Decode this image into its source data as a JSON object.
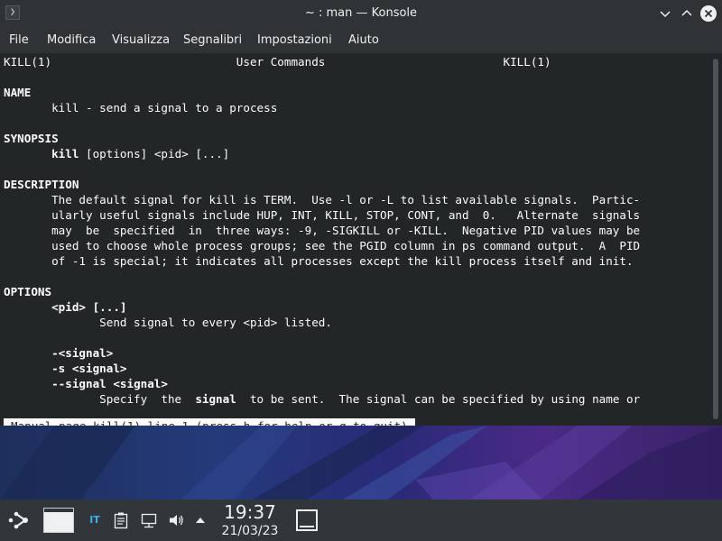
{
  "window": {
    "title": "~ : man — Konsole",
    "app_icon_glyph": "❯"
  },
  "menubar": {
    "items": [
      "File",
      "Modifica",
      "Visualizza",
      "Segnalibri",
      "Impostazioni",
      "Aiuto"
    ]
  },
  "terminal": {
    "header": "KILL(1)                           User Commands                          KILL(1)",
    "name_heading": "NAME",
    "name_line": "       kill - send a signal to a process",
    "synopsis_heading": "SYNOPSIS",
    "synopsis_cmd": "kill",
    "synopsis_rest": " [options] <pid> [...]",
    "description_heading": "DESCRIPTION",
    "description_lines": [
      "       The default signal for kill is TERM.  Use -l or -L to list available signals.  Partic-",
      "       ularly useful signals include HUP, INT, KILL, STOP, CONT, and  0.   Alternate  signals",
      "       may  be  specified  in  three ways: -9, -SIGKILL or -KILL.  Negative PID values may be",
      "       used to choose whole process groups; see the PGID column in ps command output.  A  PID",
      "       of -1 is special; it indicates all processes except the kill process itself and init."
    ],
    "options_heading": "OPTIONS",
    "opt_pid": "<pid> [...]",
    "opt_pid_desc": "              Send signal to every <pid> listed.",
    "opt_signal_1": "-<signal>",
    "opt_signal_2": "-s <signal>",
    "opt_signal_3": "--signal <signal>",
    "opt_signal_desc_pre": "              Specify  the  ",
    "opt_signal_desc_bold": "signal",
    "opt_signal_desc_post": "  to be sent.  The signal can be specified by using name or",
    "status_line": "Manual page kill(1) line 1 (press h for help or q to quit)"
  },
  "panel": {
    "keyboard_layout": "IT",
    "clock_time": "19:37",
    "clock_date": "21/03/23"
  },
  "colors": {
    "terminal_bg": "#232627",
    "terminal_fg": "#fcfcfc",
    "panel_bg": "#31363b",
    "accent": "#3daee9"
  },
  "icons": [
    "konsole-icon",
    "minimize-icon",
    "maximize-icon",
    "close-icon",
    "application-launcher-icon",
    "clipboard-icon",
    "network-icon",
    "volume-icon",
    "tray-expand-icon",
    "show-desktop-icon"
  ]
}
